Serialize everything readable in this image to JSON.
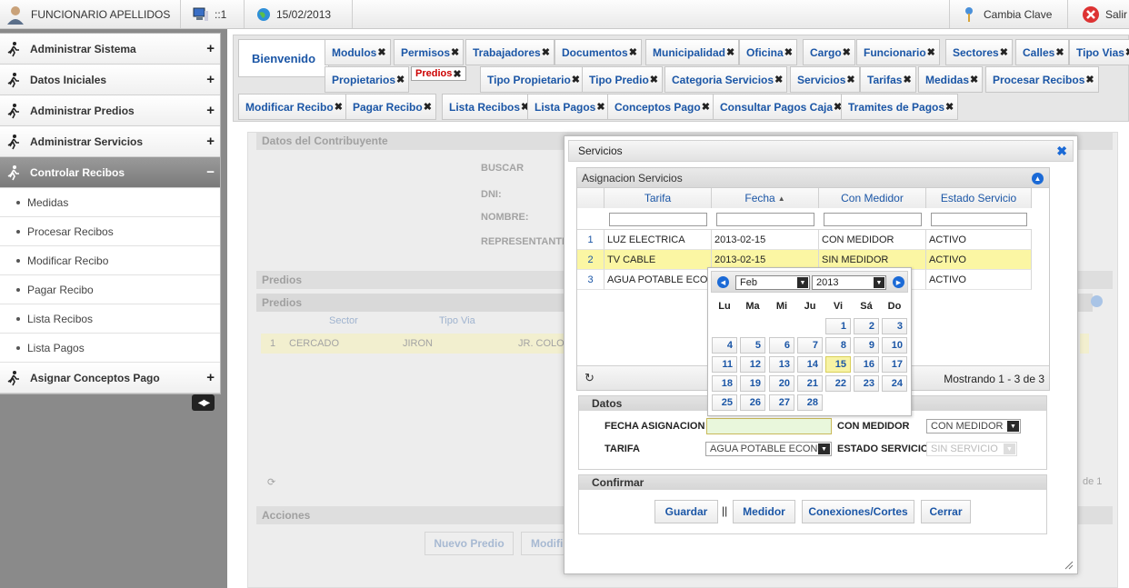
{
  "topbar": {
    "user": "FUNCIONARIO APELLIDOS",
    "terminal": "::1",
    "date": "15/02/2013",
    "change_password": "Cambia Clave",
    "exit": "Salir"
  },
  "sidebar": {
    "sections": [
      {
        "label": "Administrar Sistema",
        "sign": "+"
      },
      {
        "label": "Datos Iniciales",
        "sign": "+"
      },
      {
        "label": "Administrar Predios",
        "sign": "+"
      },
      {
        "label": "Administrar Servicios",
        "sign": "+"
      },
      {
        "label": "Controlar Recibos",
        "sign": "−"
      }
    ],
    "items": [
      "Medidas",
      "Procesar Recibos",
      "Modificar Recibo",
      "Pagar Recibo",
      "Lista Recibos",
      "Lista Pagos"
    ],
    "last_section": {
      "label": "Asignar Conceptos Pago",
      "sign": "+"
    },
    "toggle": "◀▶"
  },
  "tabs": {
    "welcome": "Bienvenido",
    "close_glyph": "✖",
    "row1": [
      "Modulos",
      "Permisos",
      "Trabajadores",
      "Documentos",
      "Municipalidad",
      "Oficina",
      "Cargo",
      "Funcionario",
      "Sectores",
      "Calles",
      "Tipo Vias"
    ],
    "row2": [
      "Propietarios",
      "Predios",
      "Tipo Propietario",
      "Tipo Predio",
      "Categoria Servicios",
      "Servicios",
      "Tarifas",
      "Medidas",
      "Procesar Recibos"
    ],
    "row3": [
      "Modificar Recibo",
      "Pagar Recibo",
      "Lista Recibos",
      "Lista Pagos",
      "Conceptos Pago",
      "Consultar Pagos Caja",
      "Tramites de Pagos"
    ]
  },
  "background": {
    "datos_title": "Datos del Contribuyente",
    "buscar": "BUSCAR",
    "dni": "DNI:",
    "nombre": "NOMBRE:",
    "representante": "REPRESENTANTE",
    "predios1": "Predios",
    "predios2": "Predios",
    "col_sector": "Sector",
    "col_tipovia": "Tipo Via",
    "row_num": "1",
    "row_sector": "CERCADO",
    "row_tipovia": "JIRON",
    "row_via": "JR. COLO",
    "pager_suffix": "de 1",
    "acciones": "Acciones",
    "nuevo_predio": "Nuevo Predio",
    "modificar": "Modifi"
  },
  "dialog": {
    "title": "Servicios",
    "close": "✖",
    "grid": {
      "title": "Asignacion Servicios",
      "collapse": "▲",
      "headers": [
        "Tarifa",
        "Fecha",
        "Con Medidor",
        "Estado Servicio"
      ],
      "sort_glyph": "▲",
      "rows": [
        {
          "n": "1",
          "tarifa": "LUZ ELECTRICA",
          "fecha": "2013-02-15",
          "medidor": "CON MEDIDOR",
          "estado": "ACTIVO"
        },
        {
          "n": "2",
          "tarifa": "TV CABLE",
          "fecha": "2013-02-15",
          "medidor": "SIN MEDIDOR",
          "estado": "ACTIVO"
        },
        {
          "n": "3",
          "tarifa": "AGUA POTABLE ECON",
          "fecha": "",
          "medidor": "",
          "estado": "ACTIVO"
        }
      ],
      "refresh": "↻",
      "pager_text": "Mostrando 1 - 3 de 3"
    },
    "datos": {
      "title": "Datos",
      "fecha_label": "FECHA ASIGNACION",
      "fecha_value": "",
      "medidor_label": "CON MEDIDOR",
      "medidor_value": "CON MEDIDOR",
      "tarifa_label": "TARIFA",
      "tarifa_value": "AGUA POTABLE ECONO",
      "estado_label": "ESTADO SERVICIO",
      "estado_value": "SIN SERVICIO"
    },
    "confirmar": {
      "title": "Confirmar",
      "guardar": "Guardar",
      "separator": "||",
      "medidor": "Medidor",
      "conexiones": "Conexiones/Cortes",
      "cerrar": "Cerrar"
    }
  },
  "calendar": {
    "month": "Feb",
    "year": "2013",
    "prev": "◀",
    "next": "▶",
    "weekdays": [
      "Lu",
      "Ma",
      "Mi",
      "Ju",
      "Vi",
      "Sá",
      "Do"
    ],
    "first_weekday_index": 4,
    "days_in_month": 28,
    "today": 15
  },
  "colors": {
    "link": "#1b56a6",
    "selected_tab": "#cc0000",
    "highlight_row": "#fbf6a3",
    "today": "#f7f3a4"
  }
}
